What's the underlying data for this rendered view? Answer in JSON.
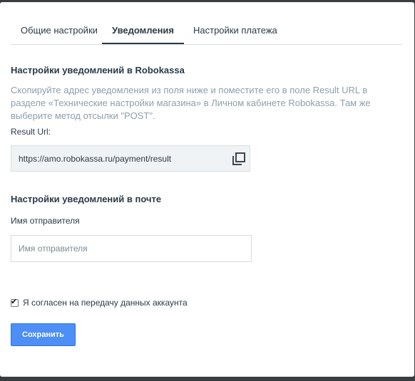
{
  "tabs": [
    {
      "label": "Общие настройки",
      "active": false
    },
    {
      "label": "Уведомления",
      "active": true
    },
    {
      "label": "Настройки платежа",
      "active": false
    }
  ],
  "robokassa": {
    "title": "Настройки уведомлений в Robokassa",
    "description": "Скопируйте адрес уведомления из поля ниже и поместите его в поле Result URL в разделе «Технические настройки магазина» в Личном кабинете Robokassa. Там же выберите метод отсылки \"POST\".",
    "result_url_label": "Result Url:",
    "result_url_value": "https://amo.robokassa.ru/payment/result",
    "copy_icon": "copy-icon"
  },
  "email": {
    "title": "Настройки уведомлений в почте",
    "sender_label": "Имя отправителя",
    "sender_value": "",
    "sender_placeholder": "Имя отправителя"
  },
  "agreement": {
    "checked": true,
    "label": "Я согласен на передачу данных аккаунта"
  },
  "save_button": {
    "label": "Сохранить"
  },
  "colors": {
    "accent": "#4e8ef7",
    "text": "#2b3a48",
    "muted": "#8da0ad",
    "backdrop": "#3a3d40"
  }
}
